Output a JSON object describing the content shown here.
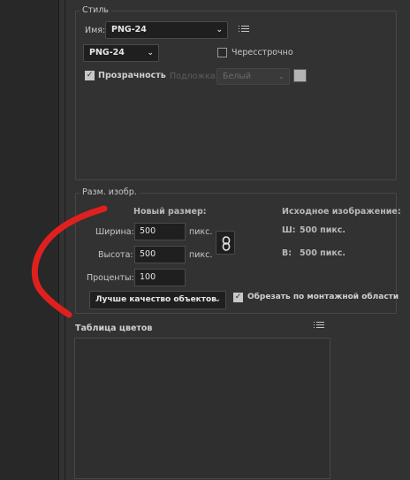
{
  "style_group": {
    "title": "Стиль",
    "name_label": "Имя:",
    "preset_value": "PNG-24",
    "format_value": "PNG-24",
    "interlaced_label": "Чересстрочно",
    "transparency_label": "Прозрачность",
    "matte_label": "Подложка:",
    "matte_value": "Белый"
  },
  "image_size_group": {
    "title": "Разм. изобр.",
    "new_size_label": "Новый размер:",
    "width_label": "Ширина:",
    "width_value": "500",
    "width_unit": "пикс.",
    "height_label": "Высота:",
    "height_value": "500",
    "height_unit": "пикс.",
    "percent_label": "Проценты:",
    "percent_value": "100",
    "original_label": "Исходное изображение:",
    "orig_w_label": "Ш:",
    "orig_w_value": "500 пикс.",
    "orig_h_label": "В:",
    "orig_h_value": "500 пикс.",
    "quality_value": "Лучше качество объектов",
    "clip_label": "Обрезать по монтажной области"
  },
  "color_table": {
    "title": "Таблица цветов"
  },
  "colors": {
    "background": "#323232",
    "annotation_stroke": "#e0201e"
  },
  "icons": {
    "menu": "menu-lines-icon",
    "link": "chain-link-icon",
    "chevron": "chevron-down-icon",
    "check": "checkmark-icon"
  }
}
